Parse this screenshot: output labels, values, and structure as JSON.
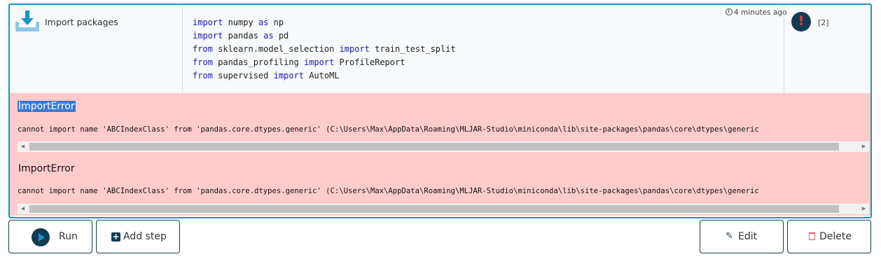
{
  "cell": {
    "step_label": "Import packages",
    "timestamp": "4 minutes ago",
    "exec_count": "[2]",
    "code_lines": [
      [
        {
          "t": "import",
          "kw": true
        },
        {
          "t": " numpy "
        },
        {
          "t": "as",
          "kw": true
        },
        {
          "t": " np"
        }
      ],
      [
        {
          "t": "import",
          "kw": true
        },
        {
          "t": " pandas "
        },
        {
          "t": "as",
          "kw": true
        },
        {
          "t": " pd"
        }
      ],
      [
        {
          "t": "from",
          "kw": true
        },
        {
          "t": " sklearn.model_selection "
        },
        {
          "t": "import",
          "kw": true
        },
        {
          "t": " train_test_split"
        }
      ],
      [
        {
          "t": "from",
          "kw": true
        },
        {
          "t": " pandas_profiling "
        },
        {
          "t": "import",
          "kw": true
        },
        {
          "t": " ProfileReport"
        }
      ],
      [
        {
          "t": "from",
          "kw": true
        },
        {
          "t": " supervised "
        },
        {
          "t": "import",
          "kw": true
        },
        {
          "t": " AutoML"
        }
      ]
    ],
    "errors": [
      {
        "title": "ImportError",
        "message": "cannot import name 'ABCIndexClass' from 'pandas.core.dtypes.generic' (C:\\Users\\Max\\AppData\\Roaming\\MLJAR-Studio\\miniconda\\lib\\site-packages\\pandas\\core\\dtypes\\generic"
      },
      {
        "title": "ImportError",
        "message": "cannot import name 'ABCIndexClass' from 'pandas.core.dtypes.generic' (C:\\Users\\Max\\AppData\\Roaming\\MLJAR-Studio\\miniconda\\lib\\site-packages\\pandas\\core\\dtypes\\generic"
      }
    ]
  },
  "buttons": {
    "run": "Run",
    "add_step": "Add step",
    "edit": "Edit",
    "delete": "Delete"
  },
  "icons": {
    "step": "download-icon",
    "timestamp": "clock-icon",
    "status": "error-icon",
    "run": "play-icon",
    "add_step": "plus-square-icon",
    "edit": "edit-icon",
    "delete": "trash-icon"
  },
  "colors": {
    "accent": "#1a94c4",
    "dark": "#123b53",
    "error_bg": "#ffcccb",
    "keyword": "#1a1aa6",
    "danger": "#e06060"
  }
}
